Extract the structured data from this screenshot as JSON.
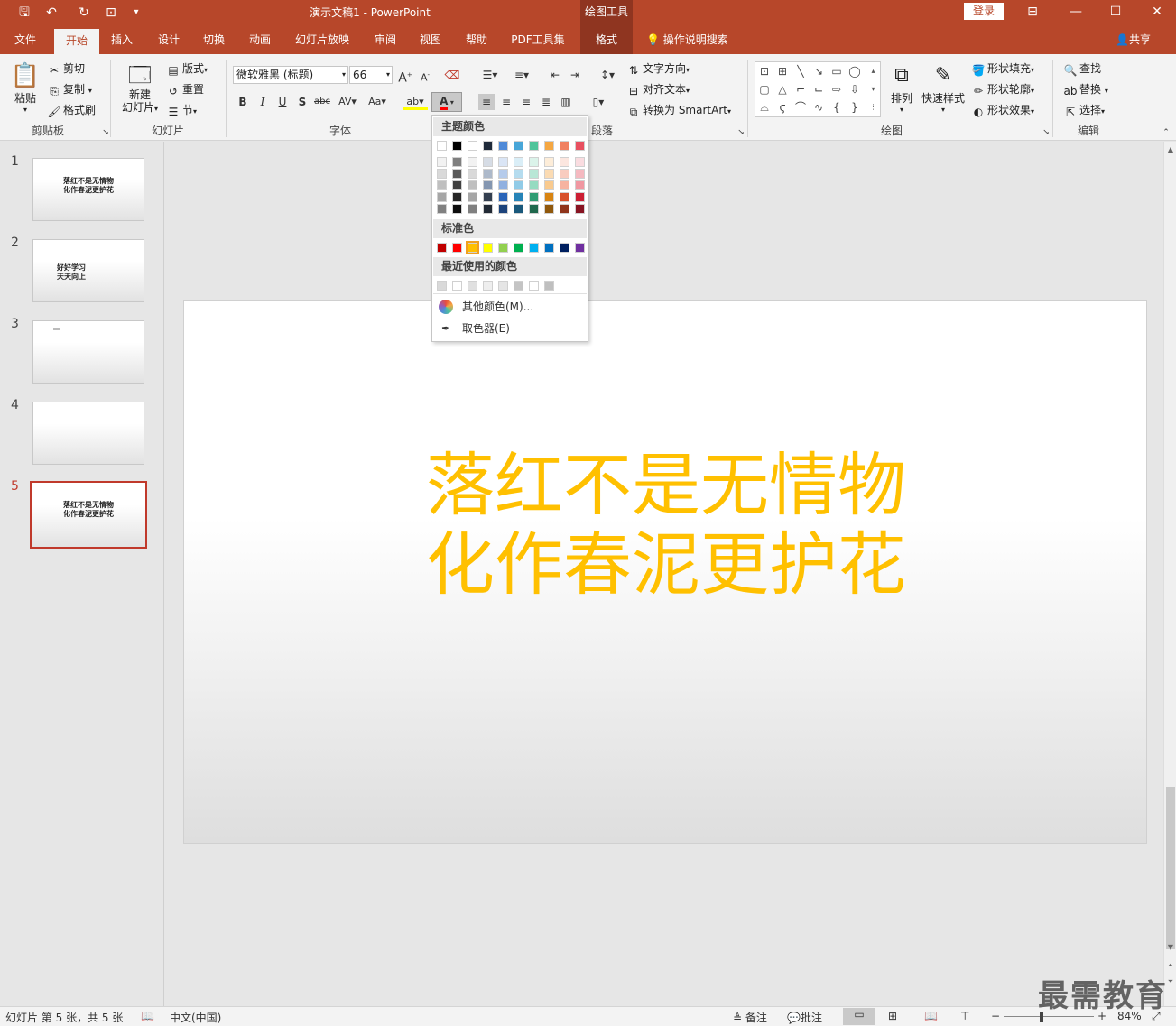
{
  "titlebar": {
    "doc_title": "演示文稿1  -  PowerPoint",
    "contextual_tab": "绘图工具",
    "login": "登录",
    "restore_icon": "⊟",
    "minimize_icon": "—",
    "maximize_icon": "☐",
    "close_icon": "✕"
  },
  "tabs": [
    "文件",
    "开始",
    "插入",
    "设计",
    "切换",
    "动画",
    "幻灯片放映",
    "审阅",
    "视图",
    "帮助",
    "PDF工具集",
    "格式"
  ],
  "search": "操作说明搜索",
  "share": "共享",
  "ribbon": {
    "clipboard": {
      "paste": "粘贴",
      "cut": "剪切",
      "copy": "复制",
      "format_painter": "格式刷",
      "label": "剪贴板"
    },
    "slides": {
      "new_slide_1": "新建",
      "new_slide_2": "幻灯片",
      "layout": "版式",
      "reset": "重置",
      "section": "节",
      "label": "幻灯片"
    },
    "font": {
      "font_name": "微软雅黑 (标题)",
      "font_size": "66",
      "label": "字体"
    },
    "paragraph": {
      "label": "段落",
      "text_direction": "文字方向",
      "align_text": "对齐文本",
      "smartart": "转换为 SmartArt"
    },
    "drawing": {
      "arrange": "排列",
      "quick_styles": "快速样式",
      "fill": "形状填充",
      "outline": "形状轮廓",
      "effects": "形状效果",
      "label": "绘图"
    },
    "editing": {
      "find": "查找",
      "replace": "替换",
      "select": "选择",
      "label": "编辑"
    }
  },
  "color_menu": {
    "theme_title": "主题颜色",
    "theme_top": [
      "#ffffff",
      "#000000",
      "#ffffff",
      "#1f2a3a",
      "#4f8ad8",
      "#48a6d8",
      "#4fc49a",
      "#f5a742",
      "#f08060",
      "#e85060"
    ],
    "theme_shades": [
      [
        "#f2f2f2",
        "#d9d9d9",
        "#bfbfbf",
        "#a6a6a6",
        "#808080"
      ],
      [
        "#7f7f7f",
        "#595959",
        "#404040",
        "#262626",
        "#0d0d0d"
      ],
      [
        "#f2f2f2",
        "#d9d9d9",
        "#bfbfbf",
        "#a6a6a6",
        "#808080"
      ],
      [
        "#d6dce5",
        "#adb9ca",
        "#8496b0",
        "#333f50",
        "#222a35"
      ],
      [
        "#dae5f5",
        "#b5cbeb",
        "#90b0e0",
        "#2a64b8",
        "#1c437b"
      ],
      [
        "#daeef7",
        "#b5dcef",
        "#91cbe7",
        "#2684b8",
        "#19587b"
      ],
      [
        "#dbf3ea",
        "#b8e7d6",
        "#95dbc1",
        "#2f9c73",
        "#1f684d"
      ],
      [
        "#fdedd9",
        "#fbdbb3",
        "#f9ca8e",
        "#d88412",
        "#90580c"
      ],
      [
        "#fce6df",
        "#f9ccbf",
        "#f6b3a0",
        "#d8502a",
        "#90351c"
      ],
      [
        "#fadce0",
        "#f5b9c0",
        "#f097a1",
        "#cc1e33",
        "#881422"
      ]
    ],
    "standard_title": "标准色",
    "standard": [
      "#c00000",
      "#ff0000",
      "#ffc000",
      "#ffff00",
      "#92d050",
      "#00b050",
      "#00b0f0",
      "#0070c0",
      "#002060",
      "#7030a0"
    ],
    "recent_title": "最近使用的颜色",
    "recent": [
      "#d9d9d9",
      "#ffffff",
      "#e0e0e0",
      "#eeeeee",
      "#e5e5e5",
      "#c4c4c4",
      "#ffffff",
      "#bfbfbf"
    ],
    "more_colors": "其他颜色(M)...",
    "eyedropper": "取色器(E)"
  },
  "slides": [
    {
      "num": "1",
      "lines": [
        "落红不是无情物",
        "化作春泥更护花"
      ]
    },
    {
      "num": "2",
      "lines": [
        "好好学习",
        "天天向上"
      ]
    },
    {
      "num": "3",
      "lines": []
    },
    {
      "num": "4",
      "lines": []
    },
    {
      "num": "5",
      "lines": [
        "落红不是无情物",
        "化作春泥更护花"
      ]
    }
  ],
  "main_slide": {
    "line1": "落红不是无情物",
    "line2": "化作春泥更护花",
    "text_color": "#ffc000"
  },
  "status": {
    "slide_info": "幻灯片 第 5 张，共 5 张",
    "language": "中文(中国)",
    "notes": "备注",
    "comments": "批注",
    "zoom": "84%"
  },
  "watermark": "最需教育"
}
